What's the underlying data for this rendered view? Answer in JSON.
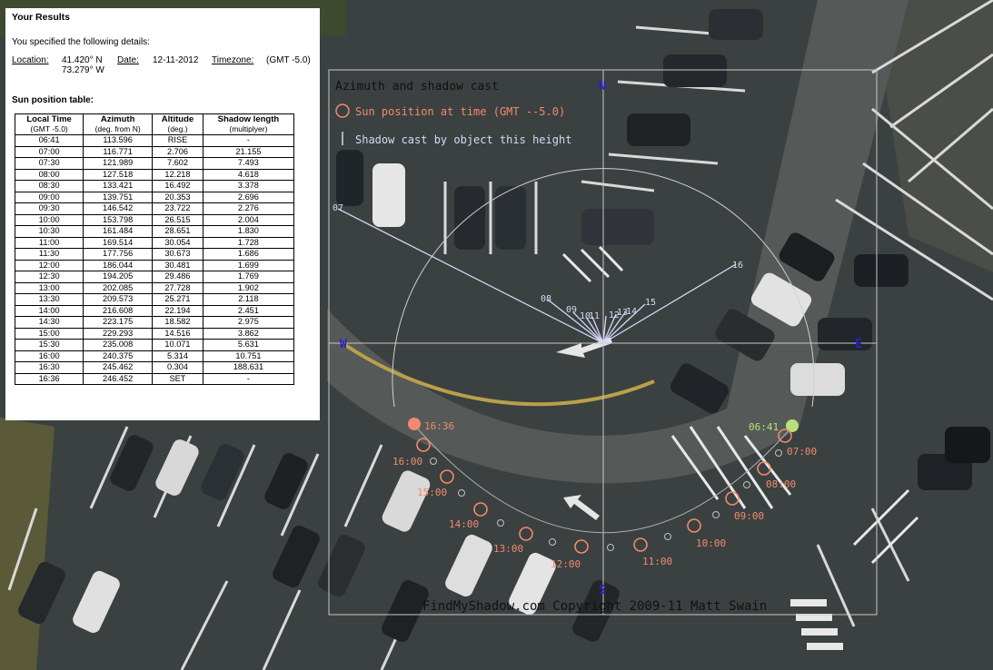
{
  "results": {
    "title": "Your Results",
    "intro": "You specified the following details:",
    "location_label": "Location:",
    "latitude": "41.420° N",
    "longitude": "73.279° W",
    "date_label": "Date:",
    "date_value": "12-11-2012",
    "timezone_label": "Timezone:",
    "timezone_value": "(GMT -5.0)",
    "table_caption": "Sun position table:",
    "columns": [
      {
        "title": "Local Time",
        "sub": "(GMT -5.0)"
      },
      {
        "title": "Azimuth",
        "sub": "(deg. from N)"
      },
      {
        "title": "Altitude",
        "sub": "(deg.)"
      },
      {
        "title": "Shadow length",
        "sub": "(multiplyer)"
      }
    ],
    "rows": [
      [
        "06:41",
        "113.596",
        "RISE",
        "-"
      ],
      [
        "07:00",
        "116.771",
        "2.706",
        "21.155"
      ],
      [
        "07:30",
        "121.989",
        "7.602",
        "7.493"
      ],
      [
        "08:00",
        "127.518",
        "12.218",
        "4.618"
      ],
      [
        "08:30",
        "133.421",
        "16.492",
        "3.378"
      ],
      [
        "09:00",
        "139.751",
        "20.353",
        "2.696"
      ],
      [
        "09:30",
        "146.542",
        "23.722",
        "2.276"
      ],
      [
        "10:00",
        "153.798",
        "26.515",
        "2.004"
      ],
      [
        "10:30",
        "161.484",
        "28.651",
        "1.830"
      ],
      [
        "11:00",
        "169.514",
        "30.054",
        "1.728"
      ],
      [
        "11:30",
        "177.756",
        "30.673",
        "1.686"
      ],
      [
        "12:00",
        "186.044",
        "30.481",
        "1.699"
      ],
      [
        "12:30",
        "194.205",
        "29.486",
        "1.769"
      ],
      [
        "13:00",
        "202.085",
        "27.728",
        "1.902"
      ],
      [
        "13:30",
        "209.573",
        "25.271",
        "2.118"
      ],
      [
        "14:00",
        "216.608",
        "22.194",
        "2.451"
      ],
      [
        "14:30",
        "223.175",
        "18.582",
        "2.975"
      ],
      [
        "15:00",
        "229.293",
        "14.516",
        "3.862"
      ],
      [
        "15:30",
        "235.008",
        "10.071",
        "5.631"
      ],
      [
        "16:00",
        "240.375",
        "5.314",
        "10.751"
      ],
      [
        "16:30",
        "245.462",
        "0.304",
        "188.631"
      ],
      [
        "16:36",
        "246.452",
        "SET",
        "-"
      ]
    ]
  },
  "diagram": {
    "legend_title": "Azimuth and shadow cast",
    "legend_sun": "Sun position at time (GMT --5.0)",
    "legend_shadow": "Shadow cast by object this height",
    "compass": {
      "north": "N",
      "south": "S",
      "east": "E",
      "west": "W"
    },
    "sun_labels": [
      "06:41",
      "07:00",
      "08:00",
      "09:00",
      "10:00",
      "11:00",
      "12:00",
      "13:00",
      "14:00",
      "15:00",
      "16:00",
      "16:36"
    ],
    "shadow_labels": [
      "07",
      "08",
      "09",
      "10",
      "11",
      "12",
      "13",
      "14",
      "15",
      "16"
    ],
    "copyright": "FindMyShadow.com Copyright 2009-11 Matt Swain",
    "colors": {
      "sun_marker": "#f08a6e",
      "sunrise_marker": "#b8e07a",
      "sunset_marker": "#f08a6e",
      "shadow_line": "#d8d8f8",
      "compass_label": "#2a1fc8",
      "frame": "#c8c8c8"
    }
  }
}
